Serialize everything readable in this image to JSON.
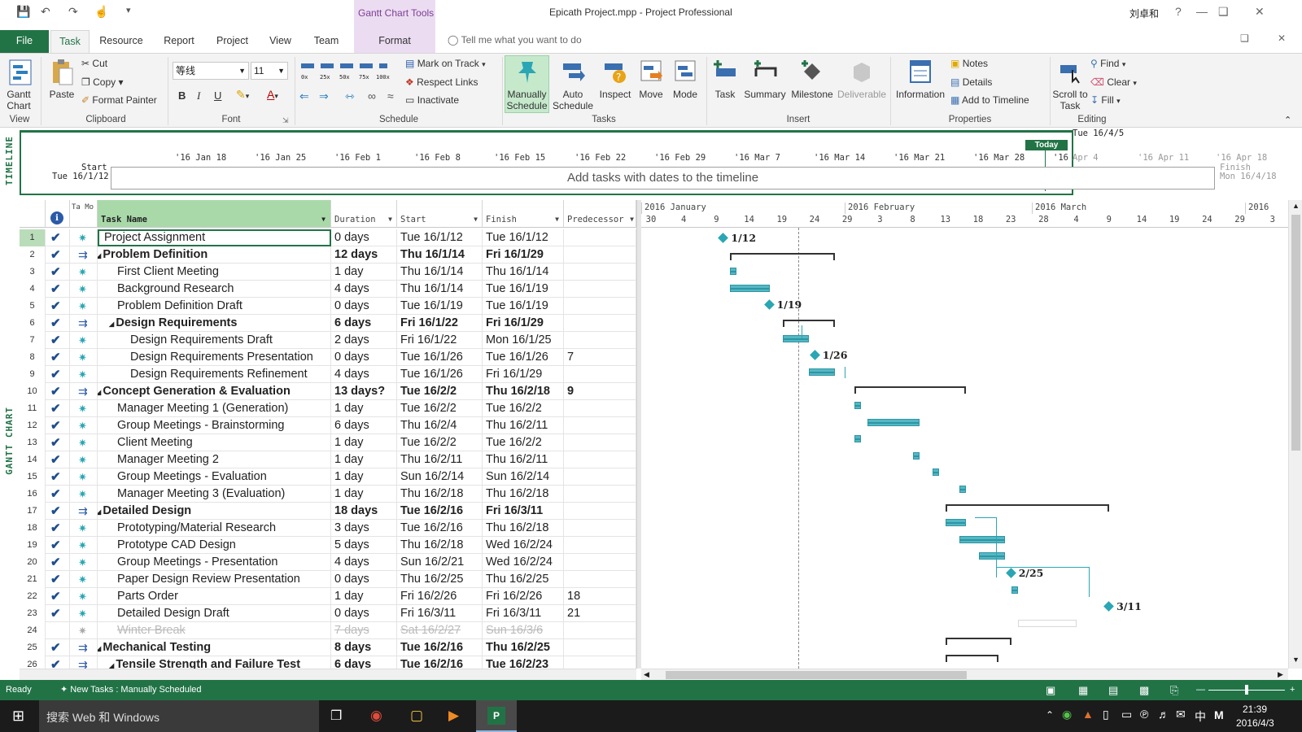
{
  "window": {
    "title": "Epicath Project.mpp - Project Professional",
    "context_tab_group": "Gantt Chart Tools",
    "user": "刘卓和",
    "help_icon": "?"
  },
  "tabs": [
    "File",
    "Task",
    "Resource",
    "Report",
    "Project",
    "View",
    "Team",
    "Format"
  ],
  "tell_me": "Tell me what you want to do",
  "ribbon": {
    "view": {
      "gantt_chart": "Gantt Chart",
      "label": "View"
    },
    "clipboard": {
      "paste": "Paste",
      "cut": "Cut",
      "copy": "Copy",
      "format_painter": "Format Painter",
      "label": "Clipboard"
    },
    "font": {
      "family": "等线",
      "size": "11",
      "label": "Font",
      "bold": "B",
      "italic": "I",
      "underline": "U"
    },
    "schedule": {
      "pcts": [
        "0x",
        "25x",
        "50x",
        "75x",
        "100x"
      ],
      "mark_on_track": "Mark on Track",
      "respect_links": "Respect Links",
      "inactivate": "Inactivate",
      "label": "Schedule"
    },
    "tasks": {
      "manually_schedule": "Manually Schedule",
      "auto_schedule": "Auto Schedule",
      "inspect": "Inspect",
      "move": "Move",
      "mode": "Mode",
      "label": "Tasks"
    },
    "insert": {
      "task": "Task",
      "summary": "Summary",
      "milestone": "Milestone",
      "deliverable": "Deliverable",
      "label": "Insert"
    },
    "properties": {
      "information": "Information",
      "notes": "Notes",
      "details": "Details",
      "add_to_timeline": "Add to Timeline",
      "label": "Properties"
    },
    "editing": {
      "scroll_to_task": "Scroll to Task",
      "find": "Find",
      "clear": "Clear",
      "fill": "Fill",
      "label": "Editing"
    }
  },
  "timeline": {
    "side_label": "TIMELINE",
    "start_label": "Start",
    "start_date": "Tue 16/1/12",
    "finish_label": "Finish",
    "finish_date": "Mon 16/4/18",
    "today": "Today",
    "today_date": "Tue 16/4/5",
    "placeholder": "Add tasks with dates to the timeline",
    "dates": [
      "'16 Jan 18",
      "'16 Jan 25",
      "'16 Feb 1",
      "'16 Feb 8",
      "'16 Feb 15",
      "'16 Feb 22",
      "'16 Feb 29",
      "'16 Mar 7",
      "'16 Mar 14",
      "'16 Mar 21",
      "'16 Mar 28",
      "'16",
      "Apr 4",
      "'16 Apr 11",
      "'16 Apr 18"
    ]
  },
  "gantt_side_label": "GANTT CHART",
  "columns": {
    "info": "i",
    "mode": "Ta Mo",
    "name": "Task Name",
    "duration": "Duration",
    "start": "Start",
    "finish": "Finish",
    "pred": "Predecessor"
  },
  "tasks": [
    {
      "id": "1",
      "name": "Project Assignment",
      "dur": "0 days",
      "start": "Tue 16/1/12",
      "finish": "Tue 16/1/12",
      "pred": "",
      "level": 0,
      "summary": false
    },
    {
      "id": "2",
      "name": "Problem Definition",
      "dur": "12 days",
      "start": "Thu 16/1/14",
      "finish": "Fri 16/1/29",
      "pred": "",
      "level": 0,
      "summary": true
    },
    {
      "id": "3",
      "name": "First Client Meeting",
      "dur": "1 day",
      "start": "Thu 16/1/14",
      "finish": "Thu 16/1/14",
      "pred": "",
      "level": 1,
      "summary": false
    },
    {
      "id": "4",
      "name": "Background Research",
      "dur": "4 days",
      "start": "Thu 16/1/14",
      "finish": "Tue 16/1/19",
      "pred": "",
      "level": 1,
      "summary": false
    },
    {
      "id": "5",
      "name": "Problem Definition Draft",
      "dur": "0 days",
      "start": "Tue 16/1/19",
      "finish": "Tue 16/1/19",
      "pred": "",
      "level": 1,
      "summary": false
    },
    {
      "id": "6",
      "name": "Design Requirements",
      "dur": "6 days",
      "start": "Fri 16/1/22",
      "finish": "Fri 16/1/29",
      "pred": "",
      "level": 1,
      "summary": true
    },
    {
      "id": "7",
      "name": "Design Requirements Draft",
      "dur": "2 days",
      "start": "Fri 16/1/22",
      "finish": "Mon 16/1/25",
      "pred": "",
      "level": 2,
      "summary": false
    },
    {
      "id": "8",
      "name": "Design Requirements Presentation",
      "dur": "0 days",
      "start": "Tue 16/1/26",
      "finish": "Tue 16/1/26",
      "pred": "7",
      "level": 2,
      "summary": false
    },
    {
      "id": "9",
      "name": "Design Requirements Refinement",
      "dur": "4 days",
      "start": "Tue 16/1/26",
      "finish": "Fri 16/1/29",
      "pred": "",
      "level": 2,
      "summary": false
    },
    {
      "id": "10",
      "name": "Concept Generation & Evaluation",
      "dur": "13 days?",
      "start": "Tue 16/2/2",
      "finish": "Thu 16/2/18",
      "pred": "9",
      "level": 0,
      "summary": true
    },
    {
      "id": "11",
      "name": "Manager Meeting 1 (Generation)",
      "dur": "1 day",
      "start": "Tue 16/2/2",
      "finish": "Tue 16/2/2",
      "pred": "",
      "level": 1,
      "summary": false
    },
    {
      "id": "12",
      "name": "Group Meetings - Brainstorming",
      "dur": "6 days",
      "start": "Thu 16/2/4",
      "finish": "Thu 16/2/11",
      "pred": "",
      "level": 1,
      "summary": false
    },
    {
      "id": "13",
      "name": "Client Meeting",
      "dur": "1 day",
      "start": "Tue 16/2/2",
      "finish": "Tue 16/2/2",
      "pred": "",
      "level": 1,
      "summary": false
    },
    {
      "id": "14",
      "name": "Manager Meeting 2",
      "dur": "1 day",
      "start": "Thu 16/2/11",
      "finish": "Thu 16/2/11",
      "pred": "",
      "level": 1,
      "summary": false
    },
    {
      "id": "15",
      "name": "Group Meetings - Evaluation",
      "dur": "1 day",
      "start": "Sun 16/2/14",
      "finish": "Sun 16/2/14",
      "pred": "",
      "level": 1,
      "summary": false
    },
    {
      "id": "16",
      "name": "Manager Meeting 3 (Evaluation)",
      "dur": "1 day",
      "start": "Thu 16/2/18",
      "finish": "Thu 16/2/18",
      "pred": "",
      "level": 1,
      "summary": false
    },
    {
      "id": "17",
      "name": "Detailed Design",
      "dur": "18 days",
      "start": "Tue 16/2/16",
      "finish": "Fri 16/3/11",
      "pred": "",
      "level": 0,
      "summary": true
    },
    {
      "id": "18",
      "name": "Prototyping/Material Research",
      "dur": "3 days",
      "start": "Tue 16/2/16",
      "finish": "Thu 16/2/18",
      "pred": "",
      "level": 1,
      "summary": false
    },
    {
      "id": "19",
      "name": "Prototype CAD Design",
      "dur": "5 days",
      "start": "Thu 16/2/18",
      "finish": "Wed 16/2/24",
      "pred": "",
      "level": 1,
      "summary": false
    },
    {
      "id": "20",
      "name": "Group Meetings - Presentation",
      "dur": "4 days",
      "start": "Sun 16/2/21",
      "finish": "Wed 16/2/24",
      "pred": "",
      "level": 1,
      "summary": false
    },
    {
      "id": "21",
      "name": "Paper Design Review Presentation",
      "dur": "0 days",
      "start": "Thu 16/2/25",
      "finish": "Thu 16/2/25",
      "pred": "",
      "level": 1,
      "summary": false
    },
    {
      "id": "22",
      "name": "Parts Order",
      "dur": "1 day",
      "start": "Fri 16/2/26",
      "finish": "Fri 16/2/26",
      "pred": "18",
      "level": 1,
      "summary": false
    },
    {
      "id": "23",
      "name": "Detailed Design Draft",
      "dur": "0 days",
      "start": "Fri 16/3/11",
      "finish": "Fri 16/3/11",
      "pred": "21",
      "level": 1,
      "summary": false
    },
    {
      "id": "24",
      "name": "Winter Break",
      "dur": "7 days",
      "start": "Sat 16/2/27",
      "finish": "Sun 16/3/6",
      "pred": "",
      "level": 1,
      "summary": false,
      "inactive": true
    },
    {
      "id": "25",
      "name": "Mechanical Testing",
      "dur": "8 days",
      "start": "Tue 16/2/16",
      "finish": "Thu 16/2/25",
      "pred": "",
      "level": 0,
      "summary": true
    },
    {
      "id": "26",
      "name": "Tensile Strength and Failure Test",
      "dur": "6 days",
      "start": "Tue 16/2/16",
      "finish": "Tue 16/2/23",
      "pred": "",
      "level": 1,
      "summary": true
    }
  ],
  "chart_header": {
    "months": [
      "2016 January",
      "2016 February",
      "2016 March",
      "2016"
    ],
    "days": [
      "30",
      "4",
      "9",
      "14",
      "19",
      "24",
      "29",
      "3",
      "8",
      "13",
      "18",
      "23",
      "28",
      "4",
      "9",
      "14",
      "19",
      "24",
      "29",
      "3"
    ]
  },
  "milestone_labels": {
    "m1": "1/12",
    "m5": "1/19",
    "m8": "1/26",
    "m21": "2/25",
    "m23": "3/11"
  },
  "status": {
    "ready": "Ready",
    "new_tasks": "New Tasks : Manually Scheduled"
  },
  "taskbar": {
    "search": "搜索 Web 和 Windows",
    "time": "21:39",
    "date": "2016/4/3",
    "ime": "中"
  }
}
